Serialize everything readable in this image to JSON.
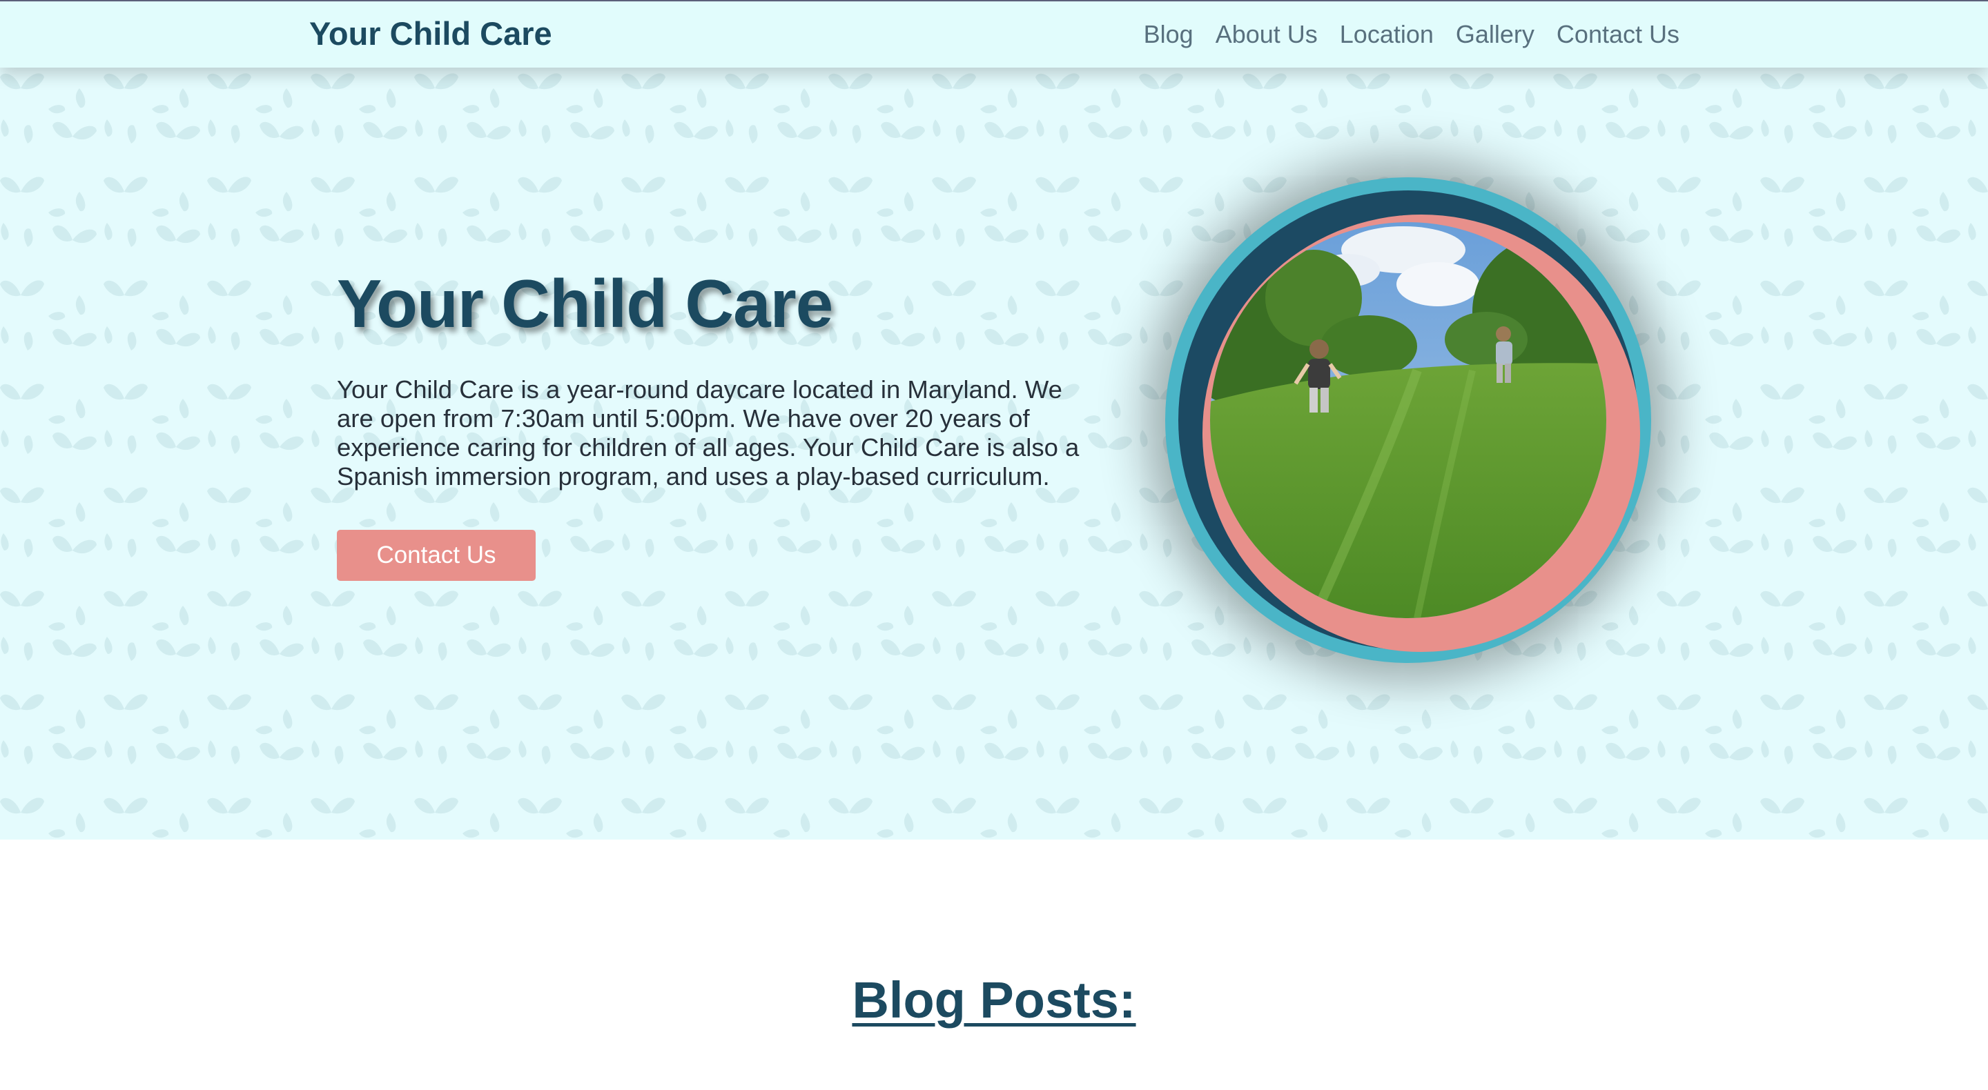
{
  "navbar": {
    "brand": "Your Child Care",
    "links": [
      "Blog",
      "About Us",
      "Location",
      "Gallery",
      "Contact Us"
    ]
  },
  "hero": {
    "title": "Your Child Care",
    "description": "Your Child Care is a year-round daycare located in Maryland. We are open from 7:30am until 5:00pm. We have over 20 years of experience caring for children of all ages. Your Child Care is also a Spanish immersion program, and uses a play-based curriculum.",
    "cta_label": "Contact Us",
    "photo_icon": "children-running-on-grass-photo"
  },
  "blog": {
    "heading": "Blog Posts:"
  },
  "colors": {
    "navy": "#1c4a60",
    "pink": "#e8908b",
    "teal": "#4ab5c7",
    "hero_bg": "#e4fbfd",
    "navbar_bg": "#e1fcfc"
  }
}
